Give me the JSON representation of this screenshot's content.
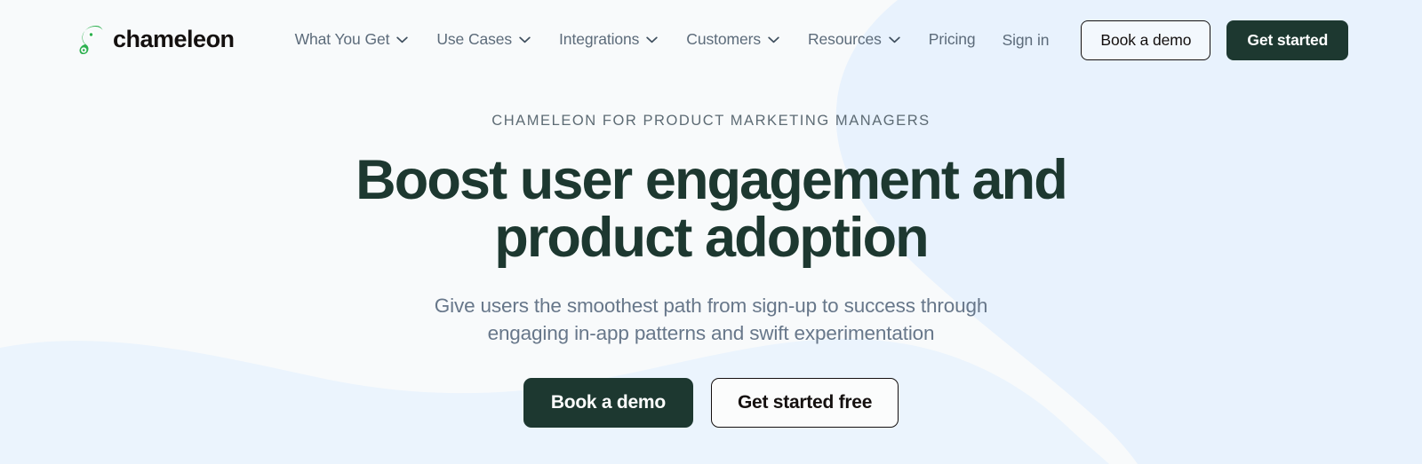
{
  "brand": {
    "name": "chameleon",
    "logo_icon": "chameleon-logo-icon",
    "logo_color": "#2db14f"
  },
  "theme": {
    "page_background": "#f8fafb",
    "blob_blue": "#e8f2fd",
    "dark_green": "#1d3830",
    "nav_text": "#5c6b7a",
    "muted_text": "#67778a",
    "eyebrow_text": "#5d6b74"
  },
  "header": {
    "nav": [
      {
        "label": "What You Get",
        "has_dropdown": true
      },
      {
        "label": "Use Cases",
        "has_dropdown": true
      },
      {
        "label": "Integrations",
        "has_dropdown": true
      },
      {
        "label": "Customers",
        "has_dropdown": true
      },
      {
        "label": "Resources",
        "has_dropdown": true
      },
      {
        "label": "Pricing",
        "has_dropdown": false
      }
    ],
    "sign_in_label": "Sign in",
    "book_demo_label": "Book a demo",
    "get_started_label": "Get started"
  },
  "hero": {
    "eyebrow": "CHAMELEON FOR PRODUCT MARKETING MANAGERS",
    "title_line_1": "Boost user engagement and",
    "title_line_2": "product adoption",
    "subtitle": "Give users the smoothest path from sign-up to success through engaging in-app patterns and swift experimentation",
    "primary_cta": "Book a demo",
    "secondary_cta": "Get started free"
  }
}
